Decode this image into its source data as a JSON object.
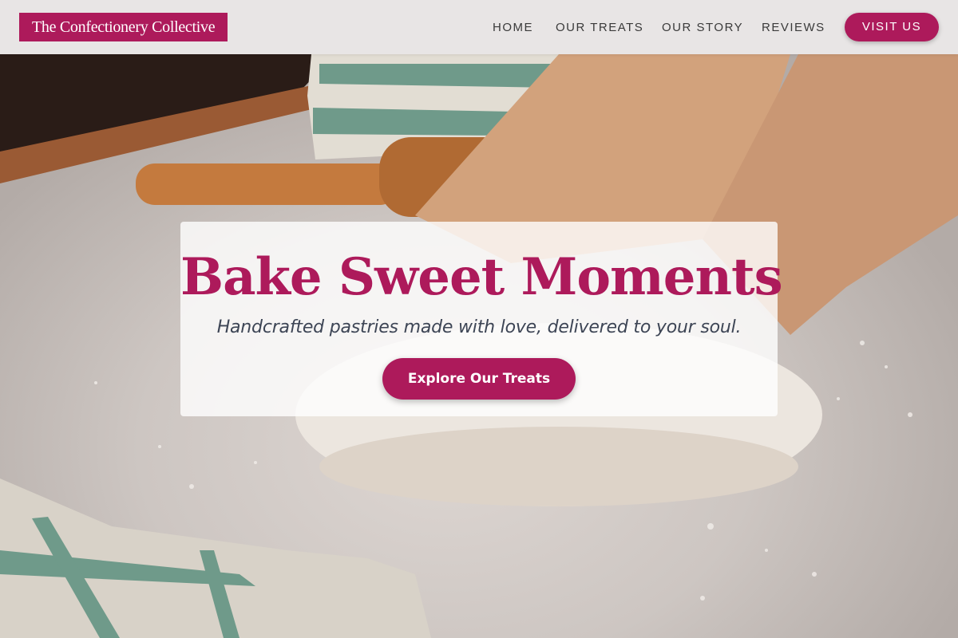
{
  "brand": {
    "name": "The Confectionery Collective"
  },
  "nav": {
    "items": [
      {
        "label": "HOME"
      },
      {
        "label": "OUR TREATS"
      },
      {
        "label": "OUR STORY"
      },
      {
        "label": "REVIEWS"
      }
    ],
    "cta_label": "VISIT US"
  },
  "hero": {
    "title": "Bake Sweet Moments",
    "subtitle": "Handcrafted pastries made with love, delivered to your soul.",
    "cta_label": "Explore Our Treats"
  },
  "colors": {
    "accent": "#ad1a5b",
    "subtitle_text": "#3d4555",
    "nav_text": "#3a3a3a",
    "nav_background": "#eceae9"
  }
}
